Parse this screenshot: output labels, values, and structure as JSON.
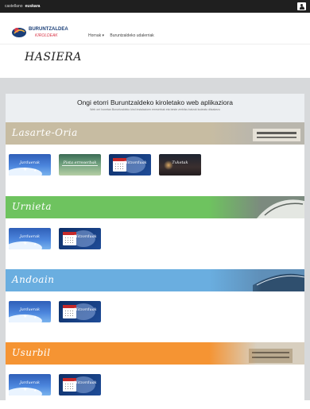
{
  "topbar": {
    "languages": [
      "castellano",
      "euskara"
    ]
  },
  "brand": {
    "name": "BURUNTZALDEA",
    "subtitle": "KIROLDEAK"
  },
  "nav": {
    "items": [
      "Hornak ▾",
      "Buruntzaldeko udalerriak"
    ]
  },
  "page": {
    "title": "HASIERA"
  },
  "welcome": {
    "heading": "Ongi etorri Buruntzaldeko kiroletako web aplikaziora",
    "subtext": "Web orri honetan Buruntzaldeko kirol instalazioen erreserbak eta beste zerbitzu batzuk kudeatu ditzakezu"
  },
  "sections": [
    {
      "name": "Lasarte-Oria",
      "color": "#c7bca2",
      "tiles": [
        {
          "label": "Jarduerak",
          "icon": "activities-icon"
        },
        {
          "label": "Pista erreserbak",
          "icon": "court-icon"
        },
        {
          "label": "Hitzorduak",
          "icon": "calendar-icon"
        },
        {
          "label": "Txketak",
          "icon": "tickets-icon"
        }
      ]
    },
    {
      "name": "Urnieta",
      "color": "#6ec35f",
      "tiles": [
        {
          "label": "Jarduerak",
          "icon": "activities-icon"
        },
        {
          "label": "Hitzorduak",
          "icon": "calendar-icon"
        }
      ]
    },
    {
      "name": "Andoain",
      "color": "#6aaee0",
      "tiles": [
        {
          "label": "Jarduerak",
          "icon": "activities-icon"
        },
        {
          "label": "Hitzorduak",
          "icon": "calendar-icon"
        }
      ]
    },
    {
      "name": "Usurbil",
      "color": "#f59433",
      "tiles": [
        {
          "label": "Jarduerak",
          "icon": "activities-icon"
        },
        {
          "label": "Hitzorduak",
          "icon": "calendar-icon"
        }
      ]
    }
  ]
}
